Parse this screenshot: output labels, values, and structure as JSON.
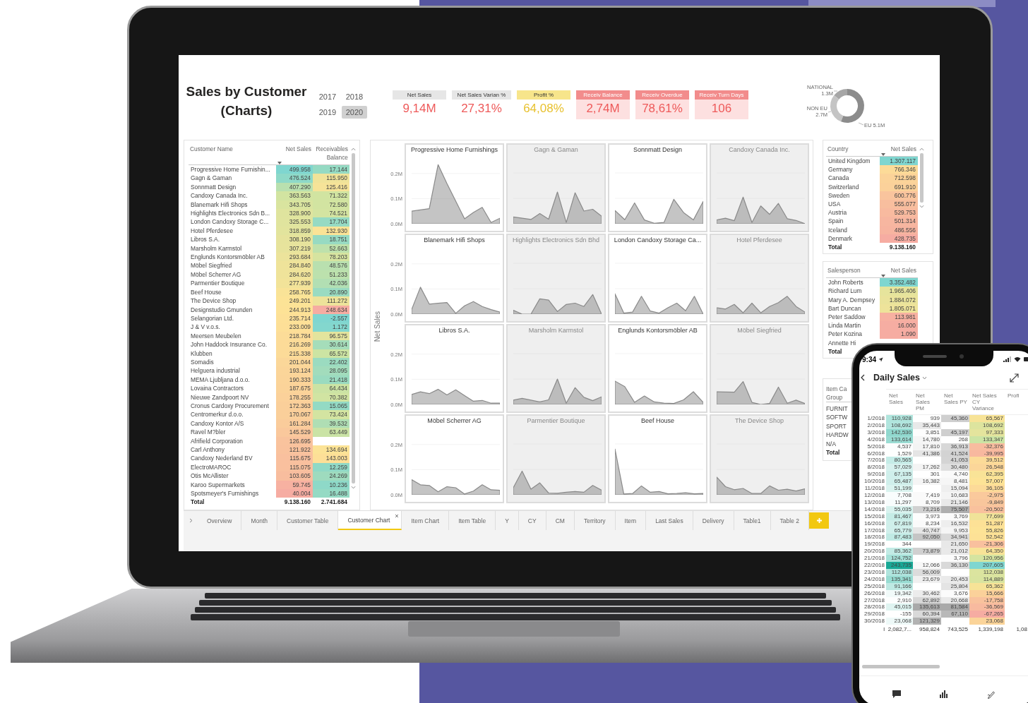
{
  "header": {
    "title": "Sales by Customer (Charts)",
    "years": [
      {
        "label": "2017",
        "selected": false
      },
      {
        "label": "2018",
        "selected": false
      },
      {
        "label": "2019",
        "selected": false
      },
      {
        "label": "2020",
        "selected": true
      }
    ]
  },
  "kpis": [
    {
      "label": "Net Sales",
      "value": "9,14M",
      "kind": "grey"
    },
    {
      "label": "Net Sales Varian %",
      "value": "27,31%",
      "kind": "grey"
    },
    {
      "label": "Profit %",
      "value": "64,08%",
      "kind": "yellow"
    },
    {
      "label": "Receiv Balance",
      "value": "2,74M",
      "kind": "red"
    },
    {
      "label": "Receiv Overdue",
      "value": "78,61%",
      "kind": "red"
    },
    {
      "label": "Receiv Turn Days",
      "value": "106",
      "kind": "red"
    }
  ],
  "donut": {
    "chart_data": {
      "type": "donut",
      "categories": [
        "NATIONAL",
        "NON EU",
        "EU"
      ],
      "values": [
        1.3,
        2.7,
        5.1
      ],
      "value_labels": [
        "1.3M",
        "2.7M",
        "5.1M"
      ]
    }
  },
  "customer_table": {
    "columns": [
      {
        "label": "Customer Name",
        "kind": "plain",
        "sorted": false
      },
      {
        "label": "Net Sales",
        "kind": "high-good",
        "sorted": true
      },
      {
        "label": "Receivables Balance",
        "kind": "low-good",
        "sorted": false
      }
    ],
    "rows": [
      [
        "Progressive Home Furnishin...",
        "499.958",
        "17.144"
      ],
      [
        "Gagn & Gaman",
        "476.524",
        "115.950"
      ],
      [
        "Sonnmatt Design",
        "407.290",
        "125.416"
      ],
      [
        "Candoxy Canada Inc.",
        "363.563",
        "71.322"
      ],
      [
        "Blanemark Hifi Shops",
        "343.705",
        "72.580"
      ],
      [
        "Highlights Electronics Sdn B...",
        "328.900",
        "74.521"
      ],
      [
        "London Candoxy Storage C...",
        "325.553",
        "17.704"
      ],
      [
        "Hotel Pferdesee",
        "318.859",
        "132.930"
      ],
      [
        "Libros S.A.",
        "308.190",
        "18.751"
      ],
      [
        "Marsholm Karmstol",
        "307.219",
        "52.663"
      ],
      [
        "Englunds Kontorsmöbler AB",
        "293.684",
        "78.203"
      ],
      [
        "Möbel Siegfried",
        "284.840",
        "48.576"
      ],
      [
        "Möbel Scherrer AG",
        "284.620",
        "51.233"
      ],
      [
        "Parmentier Boutique",
        "277.939",
        "42.036"
      ],
      [
        "Beef House",
        "258.765",
        "20.890"
      ],
      [
        "The Device Shop",
        "249.201",
        "111.272"
      ],
      [
        "Designstudio Gmunden",
        "244.913",
        "248.634"
      ],
      [
        "Selangorian Ltd.",
        "235.714",
        "-2.557"
      ],
      [
        "J & V v.o.s.",
        "233.009",
        "1.172"
      ],
      [
        "Meersen Meubelen",
        "218.784",
        "96.575"
      ],
      [
        "John Haddock Insurance Co.",
        "216.269",
        "30.614"
      ],
      [
        "Klubben",
        "215.338",
        "65.572"
      ],
      [
        "Somadis",
        "201.044",
        "22.402"
      ],
      [
        "Helguera industrial",
        "193.124",
        "28.095"
      ],
      [
        "MEMA Ljubljana d.o.o.",
        "190.333",
        "21.418"
      ],
      [
        "Lovaina Contractors",
        "187.675",
        "64.434"
      ],
      [
        "Nieuwe Zandpoort NV",
        "178.255",
        "70.382"
      ],
      [
        "Cronus Cardoxy Procurement",
        "172.363",
        "15.065"
      ],
      [
        "Centromerkur d.o.o.",
        "170.067",
        "73.424"
      ],
      [
        "Candoxy Kontor A/S",
        "161.284",
        "39.532"
      ],
      [
        "Ravel M?bler",
        "145.529",
        "63.449"
      ],
      [
        "Afrifield Corporation",
        "126.695",
        null
      ],
      [
        "Carl Anthony",
        "121.922",
        "134.694"
      ],
      [
        "Candoxy Nederland BV",
        "115.675",
        "143.003"
      ],
      [
        "ElectroMAROC",
        "115.075",
        "12.259"
      ],
      [
        "Otis McAllister",
        "103.605",
        "24.269"
      ],
      [
        "Karoo Supermarkets",
        "59.745",
        "10.236"
      ],
      [
        "Spotsmeyer's Furnishings",
        "40.004",
        "16.488"
      ]
    ],
    "total": [
      "Total",
      "9.138.160",
      "2.741.684"
    ]
  },
  "small_multiples": {
    "ylabel": "Net Sales",
    "panels": [
      {
        "title": "Progressive Home Furnishings",
        "shaded": false,
        "chart_data": {
          "type": "area",
          "categories": [
            null,
            null,
            null,
            null,
            null,
            null,
            null,
            null,
            null,
            null,
            null
          ],
          "ylim": [
            0,
            0.32
          ],
          "yticks": [
            {
              "value": 0,
              "label": "0.0M"
            },
            {
              "value": 0.1,
              "label": "0.1M"
            },
            {
              "value": 0.2,
              "label": "0.2M"
            }
          ],
          "series": [
            {
              "color": "#8a8a8a",
              "values": [
                0.05,
                0.055,
                0.06,
                0.235,
                0.16,
                0.09,
                0.02,
                0.045,
                0.065,
                0.005,
                0.022
              ]
            }
          ]
        }
      },
      {
        "title": "Gagn & Gaman",
        "shaded": true
      },
      {
        "title": "Sonnmatt Design",
        "shaded": false
      },
      {
        "title": "Candoxy Canada Inc.",
        "shaded": true
      },
      {
        "title": "Blanemark Hifi Shops",
        "shaded": false,
        "chart_data": {
          "type": "area",
          "categories": [
            null,
            null,
            null,
            null,
            null,
            null,
            null,
            null,
            null,
            null,
            null
          ],
          "ylim": [
            0,
            0.32
          ],
          "yticks": [
            {
              "value": 0,
              "label": "0.0M"
            },
            {
              "value": 0.1,
              "label": "0.1M"
            },
            {
              "value": 0.2,
              "label": "0.2M"
            }
          ],
          "series": [
            {
              "color": "#8a8a8a",
              "values": [
                0.018,
                0.107,
                0.04,
                0.043,
                0.046,
                0.003,
                0.033,
                0.05,
                0.03,
                0.018,
                0.008
              ]
            }
          ]
        }
      },
      {
        "title": "Highlights Electronics Sdn Bhd",
        "shaded": true
      },
      {
        "title": "London Candoxy Storage Ca...",
        "shaded": false
      },
      {
        "title": "Hotel Pferdesee",
        "shaded": true
      },
      {
        "title": "Libros S.A.",
        "shaded": false,
        "chart_data": {
          "type": "area",
          "categories": [
            null,
            null,
            null,
            null,
            null,
            null,
            null,
            null,
            null,
            null,
            null
          ],
          "ylim": [
            0,
            0.32
          ],
          "yticks": [
            {
              "value": 0,
              "label": "0.0M"
            },
            {
              "value": 0.1,
              "label": "0.1M"
            },
            {
              "value": 0.2,
              "label": "0.2M"
            }
          ],
          "series": [
            {
              "color": "#8a8a8a",
              "values": [
                0.04,
                0.05,
                0.043,
                0.06,
                0.038,
                0.058,
                0.035,
                0.013,
                0.016,
                0.005,
                0.005
              ]
            }
          ]
        }
      },
      {
        "title": "Marsholm Karmstol",
        "shaded": true
      },
      {
        "title": "Englunds Kontorsmöbler AB",
        "shaded": false
      },
      {
        "title": "Möbel Siegfried",
        "shaded": true
      },
      {
        "title": "Möbel Scherrer AG",
        "shaded": false,
        "chart_data": {
          "type": "area",
          "categories": [
            null,
            null,
            null,
            null,
            null,
            null,
            null,
            null,
            null,
            null,
            null
          ],
          "ylim": [
            0,
            0.32
          ],
          "yticks": [
            {
              "value": 0,
              "label": "0.0M"
            },
            {
              "value": 0.1,
              "label": "0.1M"
            },
            {
              "value": 0.2,
              "label": "0.2M"
            }
          ],
          "series": [
            {
              "color": "#8a8a8a",
              "values": [
                0.06,
                0.04,
                0.037,
                0.012,
                0.032,
                0.028,
                0.003,
                0.015,
                0.04,
                0.02,
                0.018
              ]
            }
          ]
        }
      },
      {
        "title": "Parmentier Boutique",
        "shaded": true
      },
      {
        "title": "Beef House",
        "shaded": false
      },
      {
        "title": "The Device Shop",
        "shaded": true
      }
    ]
  },
  "country_table": {
    "columns": [
      {
        "label": "Country",
        "kind": "plain",
        "sorted": false
      },
      {
        "label": "Net Sales",
        "kind": "high-good",
        "sorted": true
      }
    ],
    "rows": [
      [
        "United Kingdom",
        "1.307.117"
      ],
      [
        "Germany",
        "766.346"
      ],
      [
        "Canada",
        "712.598"
      ],
      [
        "Switzerland",
        "691.910"
      ],
      [
        "Sweden",
        "600.776"
      ],
      [
        "USA",
        "555.077"
      ],
      [
        "Austria",
        "529.753"
      ],
      [
        "Spain",
        "501.314"
      ],
      [
        "Iceland",
        "486.556"
      ],
      [
        "Denmark",
        "428.735"
      ]
    ],
    "total": [
      "Total",
      "9.138.160"
    ]
  },
  "salesperson_table": {
    "columns": [
      {
        "label": "Salesperson",
        "kind": "plain",
        "sorted": false
      },
      {
        "label": "Net Sales",
        "kind": "high-good",
        "sorted": true
      }
    ],
    "rows": [
      [
        "John Roberts",
        "3.352.482"
      ],
      [
        "Richard Lum",
        "1.965.406"
      ],
      [
        "Mary A. Dempsey",
        "1.884.072"
      ],
      [
        "Bart Duncan",
        "1.805.071"
      ],
      [
        "Peter Saddow",
        "113.981"
      ],
      [
        "Linda Martin",
        "16.000"
      ],
      [
        "Peter Kozina",
        "1.090"
      ],
      [
        "Annette Hi"
      ]
    ],
    "total": [
      "Total"
    ]
  },
  "item_table": {
    "header_lines": [
      "Item Ca",
      "Group"
    ],
    "rows": [
      "FURNIT",
      "SOFTW",
      "SPORT",
      "HARDW",
      "N/A"
    ],
    "total": "Total"
  },
  "tabs": [
    {
      "label": "Overview",
      "selected": false
    },
    {
      "label": "Month",
      "selected": false
    },
    {
      "label": "Customer Table",
      "selected": false
    },
    {
      "label": "Customer Chart",
      "selected": true
    },
    {
      "label": "Item Chart",
      "selected": false
    },
    {
      "label": "Item Table",
      "selected": false
    },
    {
      "label": "Y",
      "selected": false
    },
    {
      "label": "CY",
      "selected": false
    },
    {
      "label": "CM",
      "selected": false
    },
    {
      "label": "Territory",
      "selected": false
    },
    {
      "label": "Item",
      "selected": false
    },
    {
      "label": "Last Sales",
      "selected": false
    },
    {
      "label": "Delivery",
      "selected": false
    },
    {
      "label": "Table1",
      "selected": false
    },
    {
      "label": "Table 2",
      "selected": false
    }
  ],
  "phone": {
    "time": "9:34",
    "title": "Daily Sales",
    "columns": [
      {
        "kind": "plain"
      },
      {
        "label": "Net Sales",
        "kind": "teal"
      },
      {
        "label": "Net Sales PM",
        "kind": "grey"
      },
      {
        "label": "Net Sales PY",
        "kind": "grey"
      },
      {
        "label": "Net Sales CY Variance",
        "kind": "diverging"
      },
      {
        "label": "Profi",
        "kind": "plain"
      }
    ],
    "rows": [
      [
        "1/2018",
        "110,928",
        "939",
        "45,360",
        "65,567"
      ],
      [
        "2/2018",
        "108,692",
        "35,443",
        null,
        "108,692"
      ],
      [
        "3/2018",
        "142,530",
        "3,851",
        "45,197",
        "97,333"
      ],
      [
        "4/2018",
        "133,614",
        "14,780",
        "268",
        "133,347"
      ],
      [
        "5/2018",
        "4,537",
        "17,810",
        "36,913",
        "-32,376"
      ],
      [
        "6/2018",
        "1,529",
        "41,386",
        "41,524",
        "-39,995"
      ],
      [
        "7/2018",
        "80,565",
        null,
        "41,053",
        "39,512"
      ],
      [
        "8/2018",
        "57,029",
        "17,262",
        "30,480",
        "26,548"
      ],
      [
        "9/2018",
        "67,135",
        "301",
        "4,740",
        "62,395"
      ],
      [
        "10/2018",
        "65,487",
        "16,382",
        "8,481",
        "57,007"
      ],
      [
        "11/2018",
        "51,199",
        null,
        "15,094",
        "36,105"
      ],
      [
        "12/2018",
        "7,708",
        "7,419",
        "10,683",
        "-2,975"
      ],
      [
        "13/2018",
        "11,297",
        "8,709",
        "21,146",
        "-9,849"
      ],
      [
        "14/2018",
        "55,035",
        "73,216",
        "75,507",
        "-20,502"
      ],
      [
        "15/2018",
        "81,467",
        "3,973",
        "3,769",
        "77,699"
      ],
      [
        "16/2018",
        "67,819",
        "8,234",
        "16,532",
        "51,287"
      ],
      [
        "17/2018",
        "65,779",
        "40,747",
        "9,953",
        "55,826"
      ],
      [
        "18/2018",
        "87,483",
        "92,050",
        "34,941",
        "52,542"
      ],
      [
        "19/2018",
        "344",
        null,
        "21,650",
        "-21,306"
      ],
      [
        "20/2018",
        "85,362",
        "73,879",
        "21,012",
        "64,350"
      ],
      [
        "21/2018",
        "124,752",
        null,
        "3,796",
        "120,956"
      ],
      [
        "22/2018",
        "243,735",
        "12,066",
        "36,130",
        "207,605"
      ],
      [
        "23/2018",
        "112,038",
        "56,009",
        null,
        "112,038"
      ],
      [
        "24/2018",
        "135,341",
        "23,679",
        "20,453",
        "114,889"
      ],
      [
        "25/2018",
        "91,166",
        null,
        "25,804",
        "65,362"
      ],
      [
        "26/2018",
        "19,342",
        "30,462",
        "3,676",
        "15,666"
      ],
      [
        "27/2018",
        "2,910",
        "62,892",
        "20,668",
        "-17,758"
      ],
      [
        "28/2018",
        "45,015",
        "135,613",
        "81,584",
        "-36,569"
      ],
      [
        "29/2018",
        "-155",
        "60,394",
        "67,110",
        "-67,265"
      ],
      [
        "30/2018",
        "23,068",
        "121,329",
        null,
        "23,068"
      ]
    ],
    "total": [
      "l",
      "2,082,7...",
      "958,824",
      "743,525",
      "1,339,198",
      "1,08"
    ]
  }
}
